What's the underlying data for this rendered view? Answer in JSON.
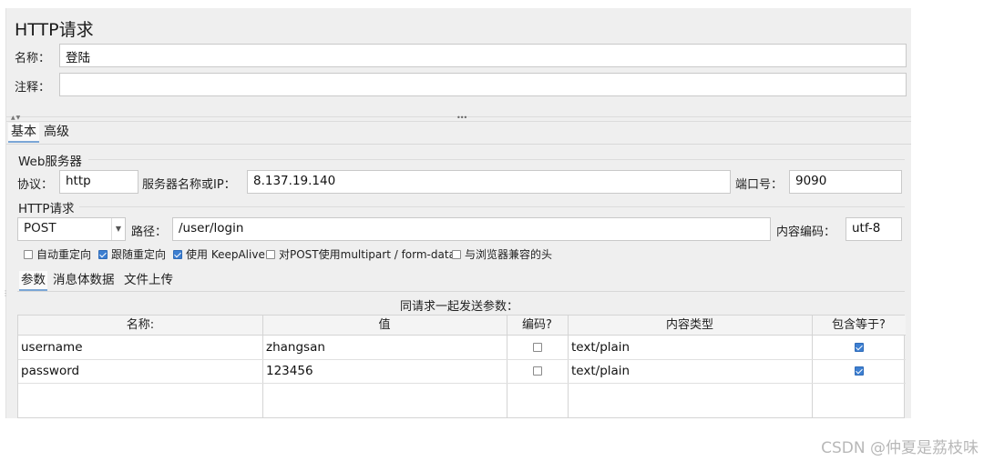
{
  "panel_title": "HTTP请求",
  "name_label": "名称：",
  "name_value": "登陆",
  "comment_label": "注释：",
  "comment_value": "",
  "tabs": {
    "basic": "基本",
    "advanced": "高级"
  },
  "web_server": {
    "group_title": "Web服务器",
    "protocol_label": "协议：",
    "protocol_value": "http",
    "server_label": "服务器名称或IP：",
    "server_value": "8.137.19.140",
    "port_label": "端口号：",
    "port_value": "9090"
  },
  "http_request": {
    "group_title": "HTTP请求",
    "method": "POST",
    "path_label": "路径：",
    "path_value": "/user/login",
    "encoding_label": "内容编码：",
    "encoding_value": "utf-8"
  },
  "options": [
    {
      "label": "自动重定向",
      "checked": false
    },
    {
      "label": "跟随重定向",
      "checked": true
    },
    {
      "label": "使用 KeepAlive",
      "checked": true
    },
    {
      "label": "对POST使用multipart / form-data",
      "checked": false
    },
    {
      "label": "与浏览器兼容的头",
      "checked": false
    }
  ],
  "param_tabs": [
    "参数",
    "消息体数据",
    "文件上传"
  ],
  "params_caption": "同请求一起发送参数：",
  "table": {
    "headers": [
      "名称:",
      "值",
      "编码?",
      "内容类型",
      "包含等于?"
    ],
    "rows": [
      {
        "name": "username",
        "value": "zhangsan",
        "encode": false,
        "content_type": "text/plain",
        "include_equals": true
      },
      {
        "name": "password",
        "value": "123456",
        "encode": false,
        "content_type": "text/plain",
        "include_equals": true
      }
    ]
  },
  "watermark": "CSDN @仲夏是荔枝味"
}
